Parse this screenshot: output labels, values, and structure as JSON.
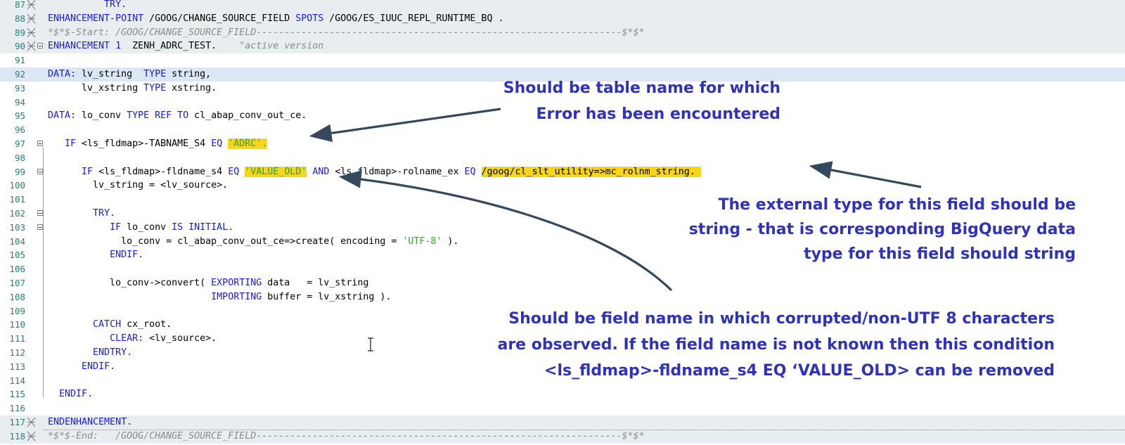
{
  "editor": {
    "lines": [
      {
        "num": "87",
        "parts": [
          {
            "t": "          TRY.",
            "c": "kw"
          }
        ]
      },
      {
        "num": "88",
        "parts": [
          {
            "t": "ENHANCEMENT-POINT",
            "c": "kw"
          },
          {
            "t": " /GOOG/CHANGE_SOURCE_FIELD "
          },
          {
            "t": "SPOTS",
            "c": "kw"
          },
          {
            "t": " /GOOG/ES_IUUC_REPL_RUNTIME_BQ ."
          }
        ]
      },
      {
        "num": "89",
        "parts": [
          {
            "t": "*$*$-Start: /GOOG/CHANGE_SOURCE_FIELD-----------------------------------------------------------------$*$*",
            "c": "cm"
          }
        ]
      },
      {
        "num": "90",
        "parts": [
          {
            "t": "ENHANCEMENT",
            "c": "kw"
          },
          {
            "t": " "
          },
          {
            "t": "1",
            "c": "num"
          },
          {
            "t": "  ZENH_ADRC_TEST.    "
          },
          {
            "t": "\"active version",
            "c": "cm"
          }
        ]
      },
      {
        "num": "91",
        "parts": [
          {
            "t": ""
          }
        ]
      },
      {
        "num": "92",
        "parts": [
          {
            "t": "DATA:",
            "c": "kw"
          },
          {
            "t": " lv_string  "
          },
          {
            "t": "TYPE",
            "c": "kw"
          },
          {
            "t": " string,"
          }
        ]
      },
      {
        "num": "93",
        "parts": [
          {
            "t": "      lv_xstring "
          },
          {
            "t": "TYPE",
            "c": "kw"
          },
          {
            "t": " xstring."
          }
        ]
      },
      {
        "num": "94",
        "parts": [
          {
            "t": ""
          }
        ]
      },
      {
        "num": "95",
        "parts": [
          {
            "t": "DATA:",
            "c": "kw"
          },
          {
            "t": " lo_conv "
          },
          {
            "t": "TYPE REF TO",
            "c": "kw"
          },
          {
            "t": " cl_abap_conv_out_ce."
          }
        ]
      },
      {
        "num": "96",
        "parts": [
          {
            "t": ""
          }
        ]
      },
      {
        "num": "97",
        "parts": [
          {
            "t": "   "
          },
          {
            "t": "IF",
            "c": "kw"
          },
          {
            "t": " <ls_fldmap>-TABNAME_S4 "
          },
          {
            "t": "EQ",
            "c": "kw"
          },
          {
            "t": " "
          },
          {
            "t": "'ADRC'.",
            "c": "str",
            "hl": true
          }
        ]
      },
      {
        "num": "98",
        "parts": [
          {
            "t": ""
          }
        ]
      },
      {
        "num": "99",
        "parts": [
          {
            "t": "      "
          },
          {
            "t": "IF",
            "c": "kw"
          },
          {
            "t": " <ls_fldmap>-fldname_s4 "
          },
          {
            "t": "EQ",
            "c": "kw"
          },
          {
            "t": " "
          },
          {
            "t": "'VALUE_OLD'",
            "c": "str",
            "hl": true
          },
          {
            "t": " "
          },
          {
            "t": "AND",
            "c": "kw"
          },
          {
            "t": " <ls_fldmap>-rolname_ex "
          },
          {
            "t": "EQ",
            "c": "kw"
          },
          {
            "t": " "
          },
          {
            "t": "/goog/cl_slt_utility=>mc_rolnm_string. ",
            "hl": true
          }
        ]
      },
      {
        "num": "100",
        "parts": [
          {
            "t": "        lv_string = <lv_source>."
          }
        ]
      },
      {
        "num": "101",
        "parts": [
          {
            "t": ""
          }
        ]
      },
      {
        "num": "102",
        "parts": [
          {
            "t": "        "
          },
          {
            "t": "TRY.",
            "c": "kw"
          }
        ]
      },
      {
        "num": "103",
        "parts": [
          {
            "t": "           "
          },
          {
            "t": "IF",
            "c": "kw"
          },
          {
            "t": " lo_conv "
          },
          {
            "t": "IS INITIAL.",
            "c": "kw"
          }
        ]
      },
      {
        "num": "104",
        "parts": [
          {
            "t": "             lo_conv = cl_abap_conv_out_ce=>create( encoding = "
          },
          {
            "t": "'UTF-8'",
            "c": "str"
          },
          {
            "t": " )."
          }
        ]
      },
      {
        "num": "105",
        "parts": [
          {
            "t": "           "
          },
          {
            "t": "ENDIF.",
            "c": "kw"
          }
        ]
      },
      {
        "num": "106",
        "parts": [
          {
            "t": ""
          }
        ]
      },
      {
        "num": "107",
        "parts": [
          {
            "t": "           lo_conv->convert( "
          },
          {
            "t": "EXPORTING",
            "c": "kw"
          },
          {
            "t": " data   = lv_string"
          }
        ]
      },
      {
        "num": "108",
        "parts": [
          {
            "t": "                             "
          },
          {
            "t": "IMPORTING",
            "c": "kw"
          },
          {
            "t": " buffer = lv_xstring )."
          }
        ]
      },
      {
        "num": "109",
        "parts": [
          {
            "t": ""
          }
        ]
      },
      {
        "num": "110",
        "parts": [
          {
            "t": "        "
          },
          {
            "t": "CATCH",
            "c": "kw"
          },
          {
            "t": " cx_root."
          }
        ]
      },
      {
        "num": "111",
        "parts": [
          {
            "t": "           "
          },
          {
            "t": "CLEAR:",
            "c": "kw"
          },
          {
            "t": " <lv_source>."
          }
        ]
      },
      {
        "num": "112",
        "parts": [
          {
            "t": "        "
          },
          {
            "t": "ENDTRY.",
            "c": "kw"
          }
        ]
      },
      {
        "num": "113",
        "parts": [
          {
            "t": "      "
          },
          {
            "t": "ENDIF.",
            "c": "kw"
          }
        ]
      },
      {
        "num": "114",
        "parts": [
          {
            "t": ""
          }
        ]
      },
      {
        "num": "115",
        "parts": [
          {
            "t": "  "
          },
          {
            "t": "ENDIF.",
            "c": "kw"
          }
        ]
      },
      {
        "num": "116",
        "parts": [
          {
            "t": ""
          }
        ]
      },
      {
        "num": "117",
        "parts": [
          {
            "t": "ENDENHANCEMENT.",
            "c": "kw"
          }
        ]
      },
      {
        "num": "118",
        "parts": [
          {
            "t": "*$*$-End:   /GOOG/CHANGE_SOURCE_FIELD-----------------------------------------------------------------$*$*",
            "c": "cm"
          }
        ]
      }
    ]
  },
  "annotations": {
    "table_note": [
      "Should be table name for which",
      "Error has  been encountered"
    ],
    "type_note": [
      "The external type for this field should be",
      "string - that is corresponding BigQuery  data",
      "type for this field should string"
    ],
    "field_note": [
      "Should be field name in which corrupted/non-UTF 8 characters",
      "are observed. If the field name is not known then this condition",
      "<ls_fldmap>-fldname_s4 EQ ‘VALUE_OLD> can be removed"
    ]
  },
  "colors": {
    "keyword": "#1a1ae6",
    "string": "#3b9a3b",
    "comment": "#8a8a8a",
    "highlight": "#f7d51d",
    "annotation": "#2f33b8",
    "arrow": "#34495e"
  }
}
